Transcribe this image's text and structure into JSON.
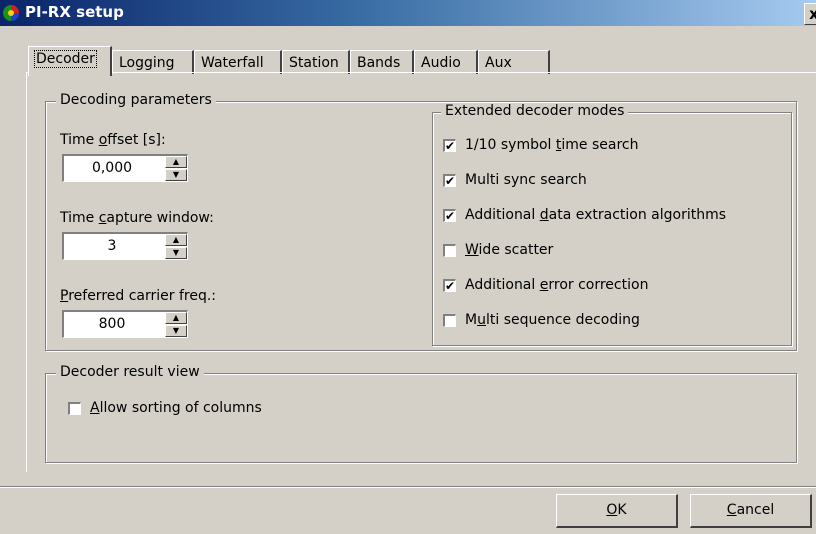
{
  "window": {
    "title": "PI-RX setup",
    "close_label": "x"
  },
  "tabs": [
    {
      "label": "Decoder"
    },
    {
      "label": "Logging"
    },
    {
      "label": "Waterfall"
    },
    {
      "label": "Station"
    },
    {
      "label": "Bands"
    },
    {
      "label": "Audio"
    },
    {
      "label": "Aux"
    }
  ],
  "decoding": {
    "legend": "Decoding parameters",
    "time_offset": {
      "label_pre": "Time ",
      "label_u": "o",
      "label_post": "ffset [s]:",
      "value": "0,000"
    },
    "capture": {
      "label_pre": "Time ",
      "label_u": "c",
      "label_post": "apture window:",
      "value": "3"
    },
    "carrier": {
      "label_pre": "",
      "label_u": "P",
      "label_post": "referred carrier freq.:",
      "value": "800"
    }
  },
  "extended": {
    "legend": "Extended decoder modes",
    "items": [
      {
        "pre": "1/10 symbol ",
        "u": "t",
        "post": "ime search",
        "checked": "✔"
      },
      {
        "pre": "Multi sync search",
        "u": "",
        "post": "",
        "checked": "✔"
      },
      {
        "pre": "Additional ",
        "u": "d",
        "post": "ata extraction algorithms",
        "checked": "✔"
      },
      {
        "pre": "",
        "u": "W",
        "post": "ide scatter",
        "checked": ""
      },
      {
        "pre": "Additional ",
        "u": "e",
        "post": "rror correction",
        "checked": "✔"
      },
      {
        "pre": "M",
        "u": "u",
        "post": "lti sequence decoding",
        "checked": ""
      }
    ]
  },
  "result_view": {
    "legend": "Decoder result view",
    "sort": {
      "pre": "",
      "u": "A",
      "post": "llow sorting of columns",
      "checked": ""
    }
  },
  "buttons": {
    "ok_u": "O",
    "ok_post": "K",
    "cancel_u": "C",
    "cancel_post": "ancel"
  },
  "colors": {
    "titlebar_start": "#0a246a",
    "titlebar_end": "#a6caf0",
    "face": "#d4d0c8"
  }
}
